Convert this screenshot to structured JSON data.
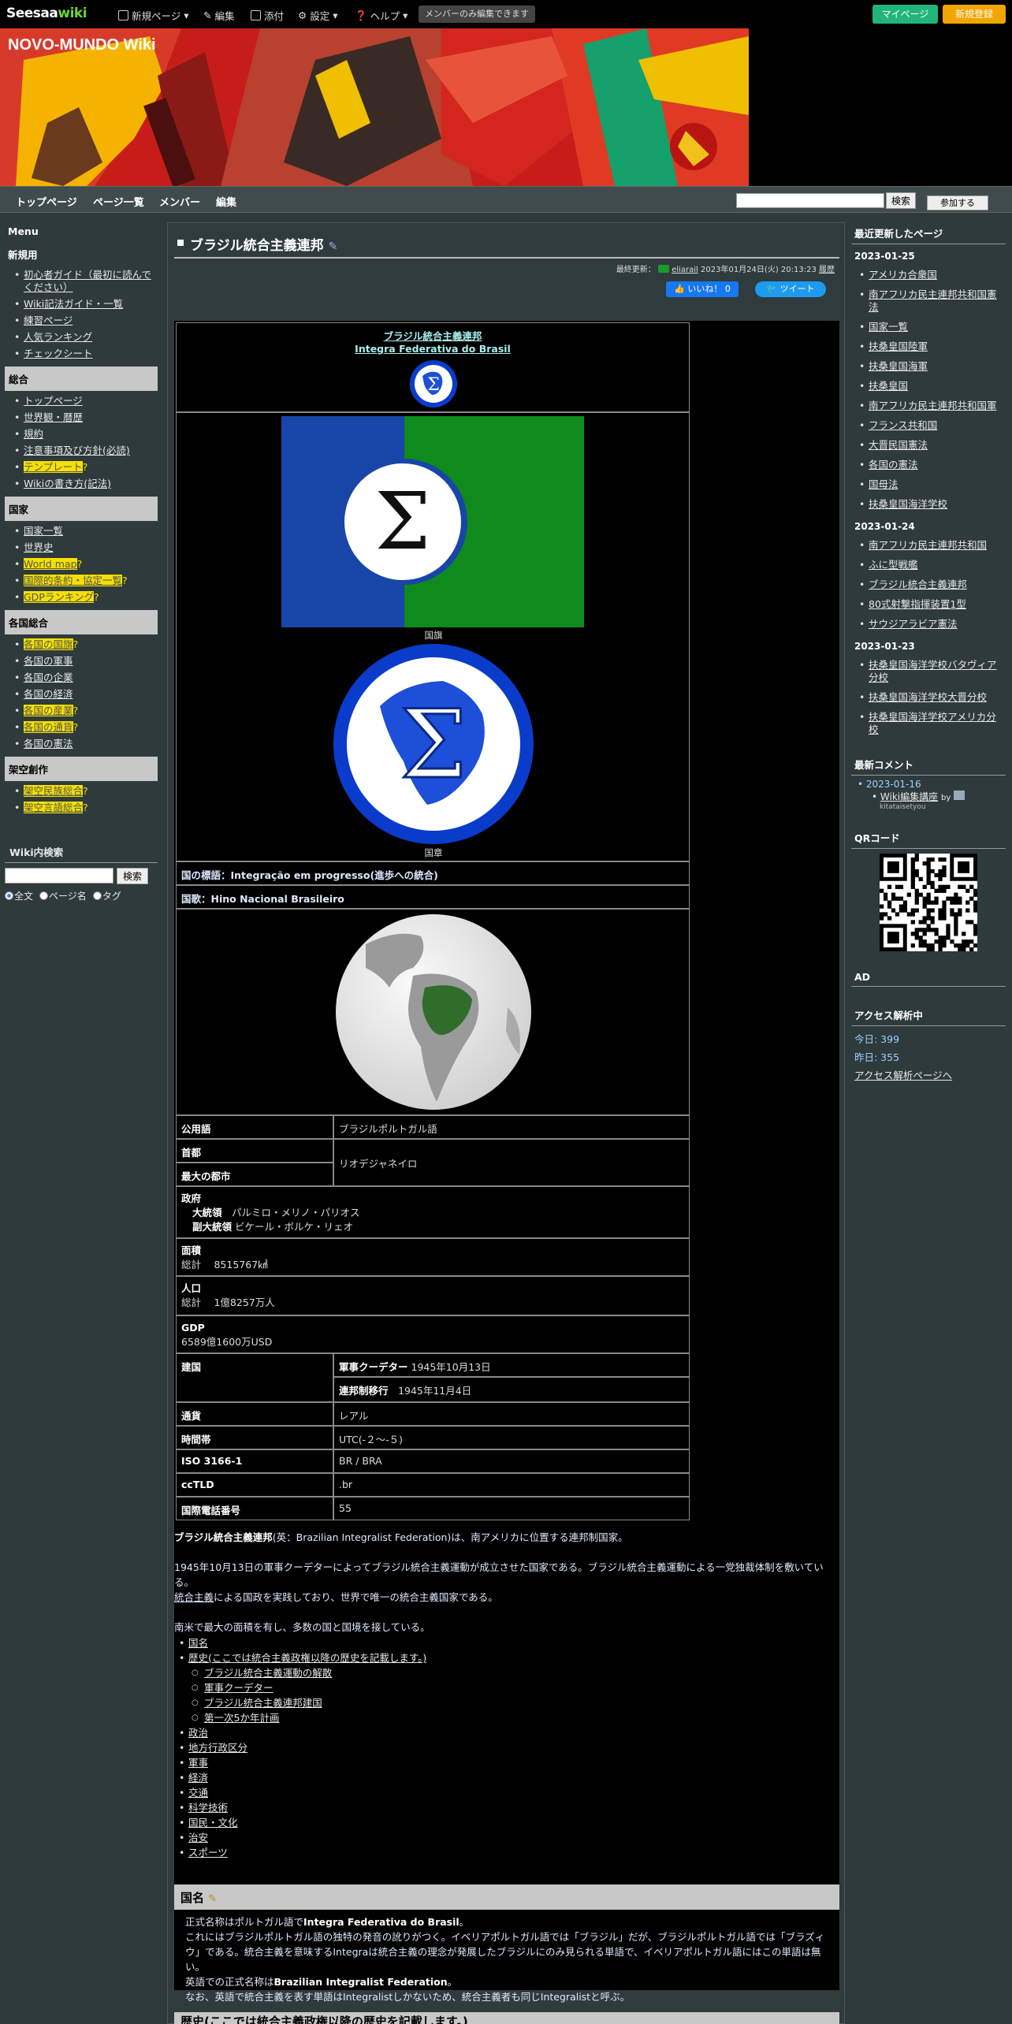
{
  "topbar": {
    "logo_main": "Seesaa",
    "logo_wiki": "wiki",
    "new_page": "新規ページ",
    "edit": "編集",
    "attach": "添付",
    "settings": "設定",
    "help": "ヘルプ",
    "member_note": "メンバーのみ編集できます",
    "mypage": "マイページ",
    "register": "新規登録"
  },
  "site": {
    "title": "NOVO-MUNDO Wiki"
  },
  "nav": {
    "items": [
      "トップページ",
      "ページ一覧",
      "メンバー",
      "編集"
    ],
    "search_btn": "検索",
    "join_btn": "参加する"
  },
  "left_menu": {
    "title": "Menu",
    "newbie_title": "新規用",
    "newbie": [
      "初心者ガイド（最初に読んでください）",
      "Wiki記法ガイド・一覧",
      "練習ページ",
      "人気ランキング",
      "チェックシート"
    ],
    "sec_general": "総合",
    "general": [
      {
        "label": "トップページ",
        "hl": false
      },
      {
        "label": "世界観・暦歴",
        "hl": false
      },
      {
        "label": "規約",
        "hl": false
      },
      {
        "label": "注意事項及び方針(必読)",
        "hl": false
      },
      {
        "label": "テンプレート",
        "hl": true
      },
      {
        "label": "Wikiの書き方(記法)",
        "hl": false
      }
    ],
    "sec_nation": "国家",
    "nation": [
      {
        "label": "国家一覧",
        "hl": false
      },
      {
        "label": "世界史",
        "hl": false
      },
      {
        "label": "World map",
        "hl": true
      },
      {
        "label": "国際的条約・協定一覧",
        "hl": true
      },
      {
        "label": "GDPランキング",
        "hl": true
      }
    ],
    "sec_each": "各国総合",
    "each": [
      {
        "label": "各国の国旗",
        "hl": true
      },
      {
        "label": "各国の軍事",
        "hl": false
      },
      {
        "label": "各国の企業",
        "hl": false
      },
      {
        "label": "各国の経済",
        "hl": false
      },
      {
        "label": "各国の産業",
        "hl": true
      },
      {
        "label": "各国の通貨",
        "hl": true
      },
      {
        "label": "各国の憲法",
        "hl": false
      }
    ],
    "sec_fiction": "架空創作",
    "fiction": [
      {
        "label": "架空民族総合",
        "hl": true
      },
      {
        "label": "架空言語総合",
        "hl": true
      }
    ],
    "search_title": "Wiki内検索",
    "search_btn": "検索",
    "radio_all": "全文",
    "radio_page": "ページ名",
    "radio_tag": "タグ"
  },
  "page": {
    "title": "ブラジル統合主義連邦",
    "meta_label": "最終更新：",
    "meta_user": "eliarail",
    "meta_date": "2023年01月24日(火) 20:13:23",
    "meta_history": "履歴",
    "like": "いいね！ 0",
    "tweet": "ツイート"
  },
  "infobox": {
    "name_ja": "ブラジル統合主義連邦",
    "name_pt": "Integra Federativa do Brasil",
    "flag_caption": "国旗",
    "emblem_caption": "国章",
    "motto": "国の標語：Integração em progresso(進歩への統合)",
    "anthem": "国歌：Hino Nacional Brasileiro",
    "rows": {
      "lang_label": "公用語",
      "lang_value": "ブラジルポルトガル語",
      "capital_label": "首都",
      "largest_label": "最大の都市",
      "capital_value": "リオデジャネイロ",
      "gov_label": "政府",
      "president_label": "大統領",
      "president_value": "パルミロ・メリノ・パリオス",
      "vice_label": "副大統領",
      "vice_value": "ビケール・ボルケ・リェオ",
      "area_label": "面積",
      "area_value": "総計　 8515767㎢",
      "pop_label": "人口",
      "pop_value": "総計　 1億8257万人",
      "gdp_label": "GDP",
      "gdp_value": "6589億1600万USD",
      "found_label": "建国",
      "coup_label": "軍事クーデター",
      "coup_value": "1945年10月13日",
      "fed_label": "連邦制移行",
      "fed_value": "1945年11月4日",
      "currency_label": "通貨",
      "currency_value": "レアル",
      "tz_label": "時間帯",
      "tz_value": "UTC(-２～-５)",
      "iso_label": "ISO 3166-1",
      "iso_value": "BR / BRA",
      "cctld_label": "ccTLD",
      "cctld_value": ".br",
      "tel_label": "国際電話番号",
      "tel_value": "55"
    }
  },
  "body": {
    "p1_bold": "ブラジル統合主義連邦",
    "p1_rest": "(英：Brazilian Integralist Federation)は、南アメリカに位置する連邦制国家。",
    "p2": "1945年10月13日の軍事クーデターによってブラジル統合主義運動が成立させた国家である。ブラジル統合主義運動による一党独裁体制を敷いている。",
    "p3_link": "統合主義",
    "p3_rest": "による国政を実践しており、世界で唯一の統合主義国家である。",
    "p4": "南米で最大の面積を有し、多数の国と国境を接している。"
  },
  "toc": [
    {
      "label": "国名",
      "sub": false
    },
    {
      "label": "歴史(ここでは統合主義政権以降の歴史を記載します。)",
      "sub": false
    },
    {
      "label": "ブラジル統合主義運動の解散",
      "sub": true
    },
    {
      "label": "軍事クーデター",
      "sub": true
    },
    {
      "label": "ブラジル統合主義連邦建国",
      "sub": true
    },
    {
      "label": "第一次5か年計画",
      "sub": true
    },
    {
      "label": "政治",
      "sub": false
    },
    {
      "label": "地方行政区分",
      "sub": false
    },
    {
      "label": "軍事",
      "sub": false
    },
    {
      "label": "経済",
      "sub": false
    },
    {
      "label": "交通",
      "sub": false
    },
    {
      "label": "科学技術",
      "sub": false
    },
    {
      "label": "国民・文化",
      "sub": false
    },
    {
      "label": "治安",
      "sub": false
    },
    {
      "label": "スポーツ",
      "sub": false
    }
  ],
  "section_name": {
    "title": "国名",
    "l1a": "正式名称はポルトガル語で",
    "l1b": "Integra Federativa do Brasil",
    "l1c": "。",
    "l2": "これにはブラジルポルトガル語の独特の発音の訛りがつく。イベリアポルトガル語では「ブラジル」だが、ブラジルポルトガル語では「ブラズィウ」である。統合主義を意味するIntegraは統合主義の理念が発展したブラジルにのみ見られる単語で、イベリアポルトガル語にはこの単語は無い。",
    "l3a": "英語での正式名称は",
    "l3b": "Brazilian Integralist Federation",
    "l3c": "。",
    "l4": "なお、英語で統合主義を表す単語はIntegralistしかないため、統合主義者も同じIntegralistと呼ぶ。"
  },
  "section_history": {
    "title": "歴史(ここでは統合主義政権以降の歴史を記載します。)"
  },
  "right": {
    "recent_title": "最近更新したページ",
    "d1": "2023-01-25",
    "d1_items": [
      "アメリカ合衆国",
      "南アフリカ民主連邦共和国憲法",
      "国家一覧",
      "扶桑皇国陸軍",
      "扶桑皇国海軍",
      "扶桑皇国",
      "南アフリカ民主連邦共和国軍",
      "フランス共和国",
      "大晋民国憲法",
      "各国の憲法",
      "国母法",
      "扶桑皇国海洋学校"
    ],
    "d2": "2023-01-24",
    "d2_items": [
      "南アフリカ民主連邦共和国",
      "ふに型戦艦",
      "ブラジル統合主義連邦",
      "80式射撃指揮装置1型",
      "サウジアラビア憲法"
    ],
    "d3": "2023-01-23",
    "d3_items": [
      "扶桑皇国海洋学校バタヴィア分校",
      "扶桑皇国海洋学校大晋分校",
      "扶桑皇国海洋学校アメリカ分校"
    ],
    "comment_title": "最新コメント",
    "comment_date": "2023-01-16",
    "comment_item": "Wiki編集講座",
    "comment_by": "by",
    "comment_user": "kitataisetyou",
    "qr_title": "QRコード",
    "ad_title": "AD",
    "access_title": "アクセス解析中",
    "today": "今日: 399",
    "yesterday": "昨日: 355",
    "access_link": "アクセス解析ページへ"
  },
  "colors": {
    "accent_green": "#22b57a",
    "accent_orange": "#f0a500",
    "flag_blue": "#1845a8",
    "flag_green": "#0f8a1c"
  }
}
